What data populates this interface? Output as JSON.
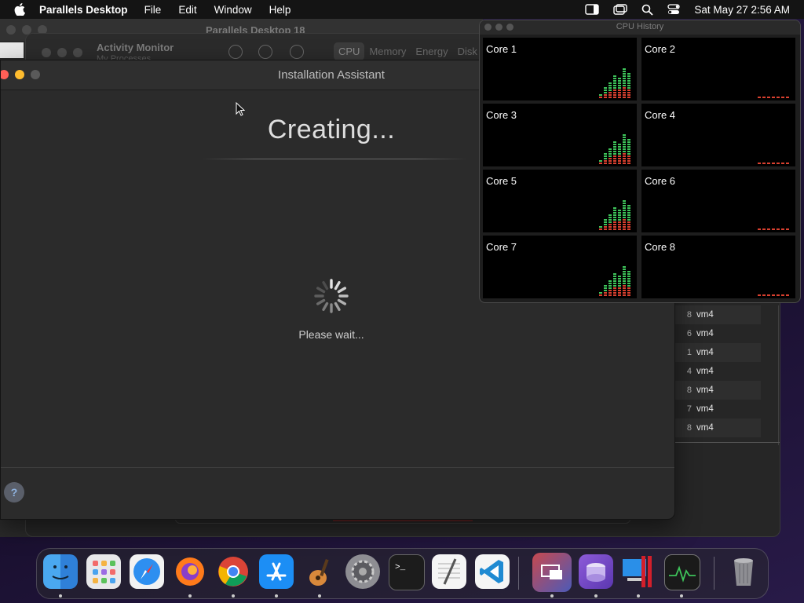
{
  "menubar": {
    "app_name": "Parallels Desktop",
    "menus": [
      "File",
      "Edit",
      "Window",
      "Help"
    ],
    "clock": "Sat May 27  2:56 AM"
  },
  "background_windows": {
    "parallels_title": "Parallels Desktop 18",
    "activity_monitor": {
      "title": "Activity Monitor",
      "subtitle": "My Processes",
      "tabs": [
        "CPU",
        "Memory",
        "Energy",
        "Disk"
      ],
      "rows": [
        {
          "num": "8",
          "user": "vm4"
        },
        {
          "num": "6",
          "user": "vm4"
        },
        {
          "num": "1",
          "user": "vm4"
        },
        {
          "num": "4",
          "user": "vm4"
        },
        {
          "num": "8",
          "user": "vm4"
        },
        {
          "num": "7",
          "user": "vm4"
        },
        {
          "num": "8",
          "user": "vm4"
        }
      ]
    }
  },
  "installation_assistant": {
    "title": "Installation Assistant",
    "heading": "Creating...",
    "status": "Please wait...",
    "help_label": "?"
  },
  "cpu_history": {
    "title": "CPU History",
    "cores": [
      "Core 1",
      "Core 2",
      "Core 3",
      "Core 4",
      "Core 5",
      "Core 6",
      "Core 7",
      "Core 8"
    ],
    "bar_colors": {
      "user": "#3ec45a",
      "system": "#d9402f"
    }
  },
  "dock": {
    "apps": [
      "finder-icon",
      "launchpad-icon",
      "safari-icon",
      "firefox-icon",
      "chrome-icon",
      "app-store-icon",
      "garageband-icon",
      "system-settings-icon",
      "terminal-icon",
      "textedit-icon",
      "vscode-icon",
      "parallels-desktop-icon",
      "installer-icon",
      "windows-vm-icon",
      "activity-monitor-icon",
      "trash-icon"
    ]
  }
}
